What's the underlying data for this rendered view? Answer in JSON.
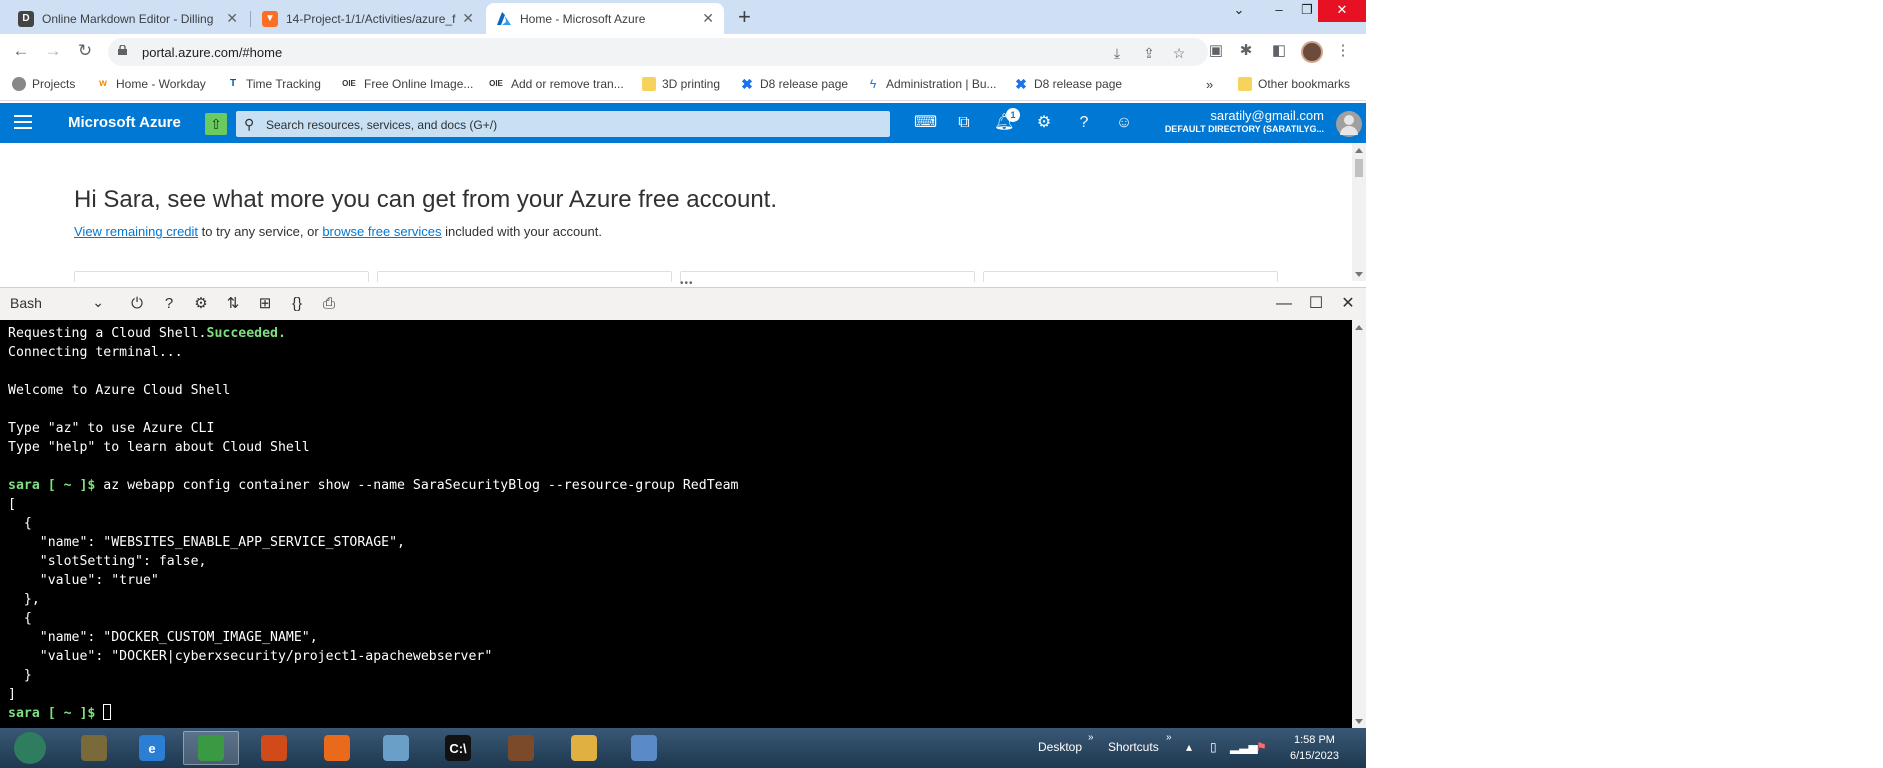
{
  "browser": {
    "tabs": [
      {
        "title": "Online Markdown Editor - Dilling",
        "favicon": "D"
      },
      {
        "title": "14-Project-1/1/Activities/azure_f",
        "favicon": "gitlab"
      },
      {
        "title": "Home - Microsoft Azure",
        "favicon": "azure",
        "active": true
      }
    ],
    "new_tab": "+",
    "window_controls": {
      "dropdown": "⌄",
      "minimize": "–",
      "restore": "❐",
      "close": "✕"
    },
    "url": "portal.azure.com/#home",
    "bookmarks": [
      {
        "label": "Projects",
        "icon": "github-icon"
      },
      {
        "label": "Home - Workday",
        "icon": "workday-icon"
      },
      {
        "label": "Time Tracking",
        "icon": "timetracking-icon"
      },
      {
        "label": "Free Online Image...",
        "icon": "oie-icon",
        "icon_text": "OIE"
      },
      {
        "label": "Add or remove tran...",
        "icon": "oie-icon",
        "icon_text": "OIE"
      },
      {
        "label": "3D printing",
        "icon": "folder-icon"
      },
      {
        "label": "D8 release page",
        "icon": "drupal-icon"
      },
      {
        "label": "Administration | Bu...",
        "icon": "bolt-icon"
      },
      {
        "label": "D8 release page",
        "icon": "drupal-icon"
      }
    ],
    "bookmarks_overflow": "»",
    "other_bookmarks": "Other bookmarks"
  },
  "azure": {
    "brand": "Microsoft Azure",
    "search_placeholder": "Search resources, services, and docs (G+/)",
    "notification_count": "1",
    "user_email": "saratily@gmail.com",
    "user_directory": "DEFAULT DIRECTORY (SARATILYG..."
  },
  "portal": {
    "greeting": "Hi Sara, see what more you can get from your Azure free account.",
    "link1": "View remaining credit",
    "mid_text": " to try any service, or ",
    "link2": "browse free services",
    "end_text": " included with your account."
  },
  "shell": {
    "type": "Bash",
    "lines": [
      {
        "prefix": "Requesting a Cloud Shell.",
        "green": "Succeeded.",
        "text": ""
      },
      {
        "text": "Connecting terminal..."
      },
      {
        "text": ""
      },
      {
        "text": "Welcome to Azure Cloud Shell"
      },
      {
        "text": ""
      },
      {
        "text": "Type \"az\" to use Azure CLI"
      },
      {
        "text": "Type \"help\" to learn about Cloud Shell"
      },
      {
        "text": ""
      },
      {
        "green": "sara [ ~ ]$",
        "text": " az webapp config container show --name SaraSecurityBlog --resource-group RedTeam"
      },
      {
        "text": "["
      },
      {
        "text": "  {"
      },
      {
        "text": "    \"name\": \"WEBSITES_ENABLE_APP_SERVICE_STORAGE\","
      },
      {
        "text": "    \"slotSetting\": false,"
      },
      {
        "text": "    \"value\": \"true\""
      },
      {
        "text": "  },"
      },
      {
        "text": "  {"
      },
      {
        "text": "    \"name\": \"DOCKER_CUSTOM_IMAGE_NAME\","
      },
      {
        "text": "    \"value\": \"DOCKER|cyberxsecurity/project1-apachewebserver\""
      },
      {
        "text": "  }"
      },
      {
        "text": "]"
      },
      {
        "green": "sara [ ~ ]$",
        "text": " ",
        "cursor": true
      }
    ]
  },
  "taskbar": {
    "apps": [
      {
        "name": "start-button",
        "color": "#2f7d5f",
        "glyph": ""
      },
      {
        "name": "tb-app-library",
        "color": "#7a6a3a",
        "glyph": ""
      },
      {
        "name": "tb-app-ie",
        "color": "#2a7fd4",
        "glyph": "e"
      },
      {
        "name": "tb-app-chrome",
        "color": "#3a9a44",
        "glyph": "",
        "highlighted": true
      },
      {
        "name": "tb-app-office",
        "color": "#d04a1a",
        "glyph": ""
      },
      {
        "name": "tb-app-firefox",
        "color": "#e86a1a",
        "glyph": ""
      },
      {
        "name": "tb-app-notepad",
        "color": "#6aa0c8",
        "glyph": ""
      },
      {
        "name": "tb-app-cmd",
        "color": "#111111",
        "glyph": "C:\\"
      },
      {
        "name": "tb-app-media",
        "color": "#7a4a2a",
        "glyph": ""
      },
      {
        "name": "tb-app-explorer",
        "color": "#e0b040",
        "glyph": ""
      },
      {
        "name": "tb-app-paint",
        "color": "#5a8ac8",
        "glyph": ""
      }
    ],
    "desktop_label": "Desktop",
    "shortcuts_label": "Shortcuts",
    "time": "1:58 PM",
    "date": "6/15/2023"
  }
}
